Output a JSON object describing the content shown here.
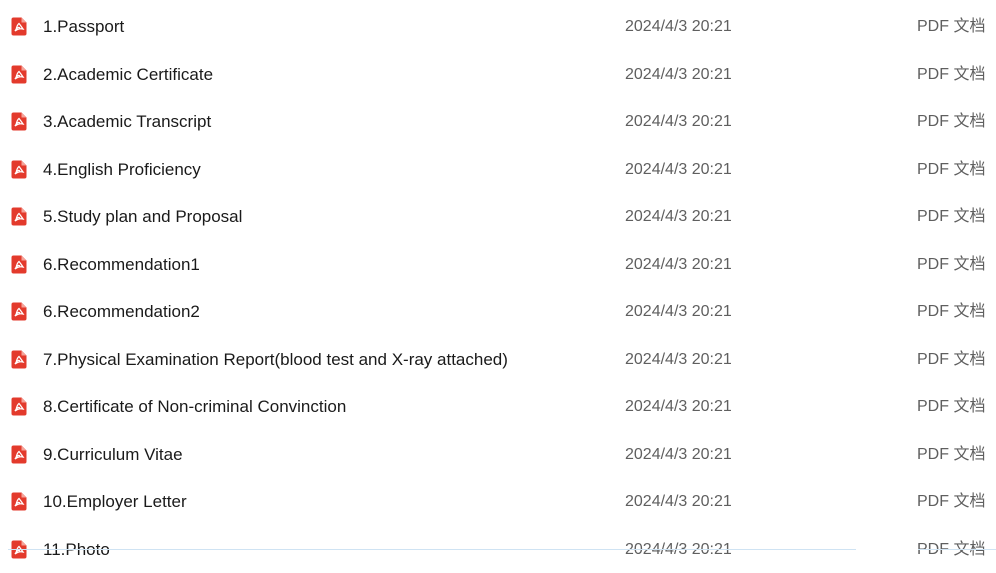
{
  "file_list": {
    "icon": "pdf-file-icon",
    "icon_color": "#e33a2c",
    "files": [
      {
        "name": "1.Passport",
        "modified": "2024/4/3 20:21",
        "type": "PDF 文档"
      },
      {
        "name": "2.Academic Certificate",
        "modified": "2024/4/3 20:21",
        "type": "PDF 文档"
      },
      {
        "name": "3.Academic Transcript",
        "modified": "2024/4/3 20:21",
        "type": "PDF 文档"
      },
      {
        "name": "4.English Proficiency",
        "modified": "2024/4/3 20:21",
        "type": "PDF 文档"
      },
      {
        "name": "5.Study plan and Proposal",
        "modified": "2024/4/3 20:21",
        "type": "PDF 文档"
      },
      {
        "name": "6.Recommendation1",
        "modified": "2024/4/3 20:21",
        "type": "PDF 文档"
      },
      {
        "name": "6.Recommendation2",
        "modified": "2024/4/3 20:21",
        "type": "PDF 文档"
      },
      {
        "name": "7.Physical Examination Report(blood test and X-ray attached)",
        "modified": "2024/4/3 20:21",
        "type": "PDF 文档"
      },
      {
        "name": "8.Certificate of Non-criminal Convinction",
        "modified": "2024/4/3 20:21",
        "type": "PDF 文档"
      },
      {
        "name": "9.Curriculum Vitae",
        "modified": "2024/4/3 20:21",
        "type": "PDF 文档"
      },
      {
        "name": "10.Employer Letter",
        "modified": "2024/4/3 20:21",
        "type": "PDF 文档"
      },
      {
        "name": "11.Photo",
        "modified": "2024/4/3 20:21",
        "type": "PDF 文档"
      }
    ]
  }
}
